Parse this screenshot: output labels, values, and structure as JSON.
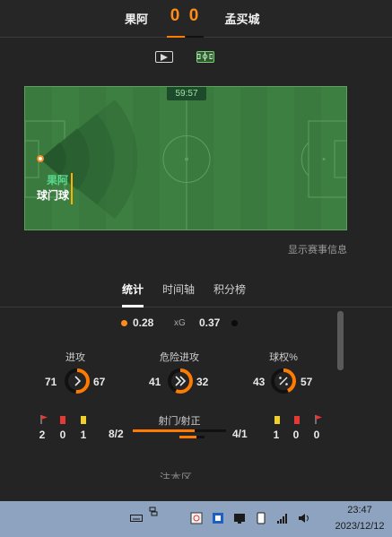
{
  "match": {
    "home_team": "果阿",
    "away_team": "孟买城",
    "home_score": "0",
    "away_score": "0"
  },
  "view_toggle": {
    "video_icon": "play-video-icon",
    "pitch_icon": "pitch-view-icon"
  },
  "pitch": {
    "clock": "59:57",
    "event_team": "果阿",
    "event_label": "球门球"
  },
  "show_match_info": "显示赛事信息",
  "tabs": [
    {
      "label": "统计",
      "active": true
    },
    {
      "label": "时间轴",
      "active": false
    },
    {
      "label": "积分榜",
      "active": false
    }
  ],
  "xg": {
    "home": "0.28",
    "label": "xG",
    "away": "0.37"
  },
  "stats": [
    {
      "title": "进攻",
      "home": "71",
      "away": "67",
      "icon": "chevron-right-icon",
      "home_share": 0.514
    },
    {
      "title": "危险进攻",
      "home": "41",
      "away": "32",
      "icon": "double-chevron-right-icon",
      "home_share": 0.562
    },
    {
      "title": "球权%",
      "home": "43",
      "away": "57",
      "icon": "percent-icon",
      "home_share": 0.43
    }
  ],
  "discipline": {
    "home": {
      "corners": "2",
      "red_cards": "0",
      "yellow_cards": "1"
    },
    "away": {
      "yellow_cards": "1",
      "red_cards": "0",
      "corners": "0"
    }
  },
  "shots": {
    "title": "射门/射正",
    "home": "8/2",
    "away": "4/1",
    "home_share": 0.667,
    "home_on_target_share": 0.667
  },
  "next_section_partial": "注本区",
  "taskbar": {
    "time": "23:47",
    "date": "2023/12/12",
    "icons": [
      "keyboard-icon",
      "ime-icon",
      "screenshot-icon",
      "app-icon",
      "display-icon",
      "tablet-icon",
      "signal-icon",
      "volume-icon"
    ]
  },
  "colors": {
    "home": "#ff7a00",
    "away": "#111111",
    "pitch": "#3d7f41"
  }
}
